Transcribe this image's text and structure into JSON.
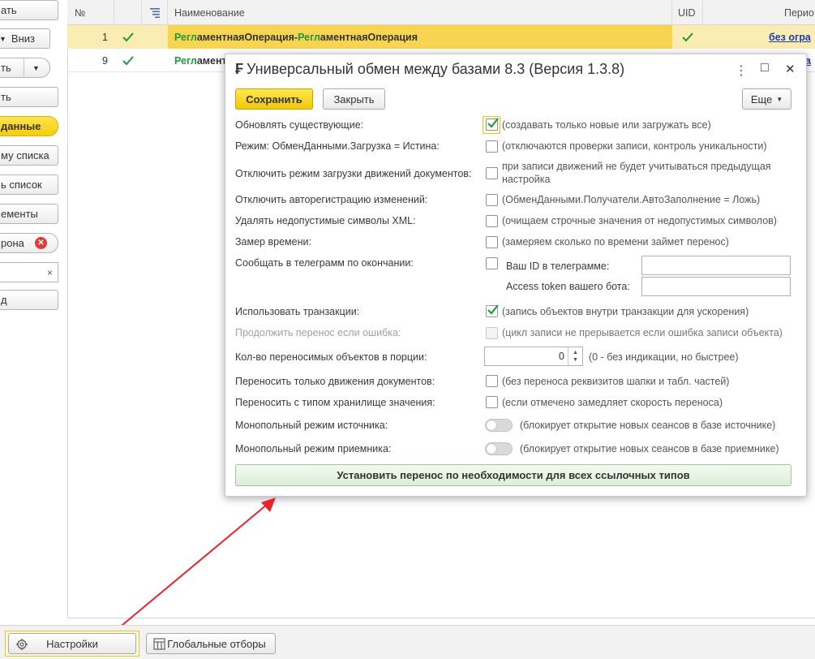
{
  "left_panel": {
    "top_button": "ать",
    "down_button": "Вниз",
    "button3": "ть",
    "data_button": "данные",
    "to_list_button": "му списка",
    "list_button": "ь список",
    "elements_button": "ементы",
    "side_field": "рона",
    "field_clear": "×",
    "bottom_button": "д"
  },
  "table": {
    "columns": [
      "№",
      "",
      "",
      "Наименование",
      "UID",
      "Перио"
    ],
    "rows": [
      {
        "num": "1",
        "name_prefix": "Регл",
        "name_rest": "аментнаяОперация",
        "name_sep": " - ",
        "name2_prefix": "Регл",
        "name2_rest": "аментнаяОперация",
        "period": "без огра"
      },
      {
        "num": "9",
        "name_prefix": "Регл",
        "name_rest": "аменть",
        "period": "а"
      }
    ]
  },
  "dialog": {
    "title": "Универсальный обмен между базами 8.3 (Версия 1.3.8)",
    "save_button": "Сохранить",
    "close_button": "Закрыть",
    "more_button": "Еще",
    "window_controls": {
      "menu": "⋮",
      "maximize": "□",
      "close": "✕"
    },
    "options": {
      "update_existing": {
        "label": "Обновлять существующие:",
        "hint": "(создавать только новые или загружать все)",
        "checked": true
      },
      "mode_load": {
        "label": "Режим: ОбменДанными.Загрузка = Истина:",
        "hint": "(отключаются проверки записи, контроль уникальности)",
        "checked": false
      },
      "disable_movements": {
        "label": "Отключить режим загрузки движений документов:",
        "hint_line1": "при записи движений не будет учитываться предыдущая",
        "hint_line2": "настройка",
        "checked": false
      },
      "disable_autoreg": {
        "label": "Отключить авторегистрацию изменений:",
        "hint": "(ОбменДанными.Получатели.АвтоЗаполнение = Ложь)",
        "checked": false
      },
      "remove_xml": {
        "label": "Удалять недопустимые символы XML:",
        "hint": "(очищаем строчные значения от недопустимых символов)",
        "checked": false
      },
      "time_measure": {
        "label": "Замер времени:",
        "hint": "(замеряем сколько по времени займет перенос)",
        "checked": false
      },
      "telegram": {
        "label": "Сообщать в телеграмм по окончании:",
        "id_label": "Ваш ID в телеграмме:",
        "id_value": "",
        "token_label": "Access token вашего бота:",
        "token_value": "",
        "checked": false
      },
      "transactions": {
        "label": "Использовать транзакции:",
        "hint": "(запись объектов внутри транзакции для ускорения)",
        "checked": true
      },
      "continue_on_error": {
        "label": "Продолжить перенос если ошибка:",
        "hint": "(цикл записи не прерывается если ошибка записи объекта)",
        "checked": false,
        "disabled": true
      },
      "portion_count": {
        "label": "Кол-во переносимых объектов в порции:",
        "value": "0",
        "hint": "(0 - без индикации, но быстрее)"
      },
      "only_movements": {
        "label": "Переносить только движения документов:",
        "hint": "(без переноса реквизитов шапки и табл. частей)",
        "checked": false
      },
      "value_storage": {
        "label": "Переносить с типом хранилище значения:",
        "hint": "(если отмечено замедляет скорость переноса)",
        "checked": false
      },
      "mono_source": {
        "label": "Монопольный режим источника:",
        "hint": "(блокирует открытие новых сеансов в базе источнике)",
        "on": false
      },
      "mono_target": {
        "label": "Монопольный режим приемника:",
        "hint": "(блокирует открытие новых сеансов в базе приемнике)",
        "on": false
      }
    },
    "set_transfer_button": "Установить перенос по необходимости для всех ссылочных типов"
  },
  "bottom_bar": {
    "settings_button": "Настройки",
    "global_filters_button": "Глобальные отборы"
  },
  "colors": {
    "accent_yellow": "#f5cc0d",
    "check_green": "#1f9a3c",
    "row_highlight": "#fbecb4",
    "annotation_red": "#e8242a"
  }
}
